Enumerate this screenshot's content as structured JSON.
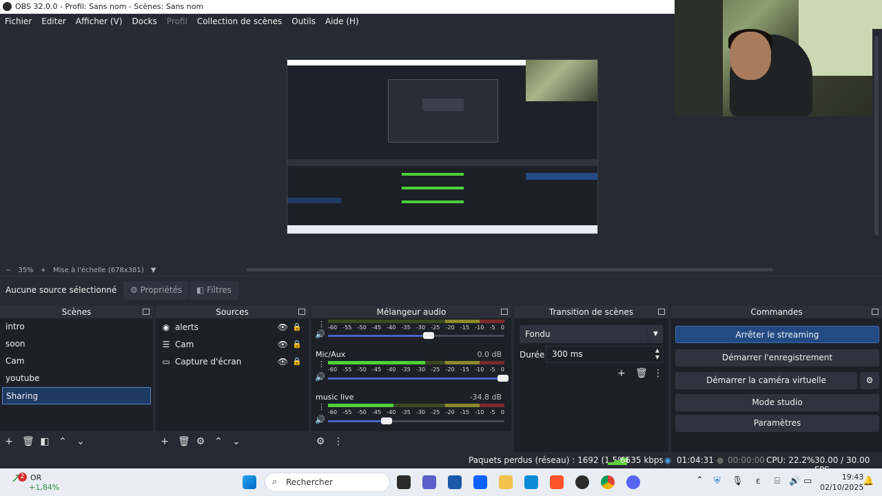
{
  "window": {
    "title": "OBS 32.0.0 - Profil: Sans nom - Scènes: Sans nom"
  },
  "menu": [
    "Fichier",
    "Editer",
    "Afficher (V)",
    "Docks",
    "Profil",
    "Collection de scènes",
    "Outils",
    "Aide (H)"
  ],
  "zoom": {
    "minus": "−",
    "value": "35%",
    "plus": "+",
    "label": "Mise à l'échelle (678x381)"
  },
  "context": {
    "no_source": "Aucune source sélectionné",
    "properties": "Propriétés",
    "filters": "Filtres"
  },
  "scenes": {
    "title": "Scènes",
    "items": [
      "intro",
      "soon",
      "Cam",
      "youtube",
      "Sharing"
    ],
    "active": "Sharing"
  },
  "sources": {
    "title": "Sources",
    "items": [
      {
        "name": "alerts",
        "icon": "browser-icon"
      },
      {
        "name": "Cam",
        "icon": "list-icon"
      },
      {
        "name": "Capture d'écran",
        "icon": "monitor-icon"
      }
    ]
  },
  "mixer": {
    "title": "Mélangeur audio",
    "ticks": [
      "-60",
      "-55",
      "-50",
      "-45",
      "-40",
      "-35",
      "-30",
      "-25",
      "-20",
      "-15",
      "-10",
      "-5",
      "0"
    ],
    "channels": [
      {
        "name": "",
        "db": "",
        "level_fraction": 0.0,
        "volume_fraction": 0.58
      },
      {
        "name": "Mic/Aux",
        "db": "0.0 dB",
        "level_fraction": 0.55,
        "volume_fraction": 1.0
      },
      {
        "name": "music live",
        "db": "-34.8 dB",
        "level_fraction": 0.37,
        "volume_fraction": 0.34
      }
    ]
  },
  "transition": {
    "title": "Transition de scènes",
    "selected": "Fondu",
    "duration_label": "Durée",
    "duration_value": "300 ms"
  },
  "commands": {
    "title": "Commandes",
    "stop_stream": "Arrêter le streaming",
    "start_recording": "Démarrer l'enregistrement",
    "virtual_cam": "Démarrer la caméra virtuelle",
    "studio_mode": "Mode studio",
    "settings": "Paramètres"
  },
  "status": {
    "dropped": "Paquets perdus (réseau) : 1692 (1.5%)",
    "bitrate": "6635 kbps",
    "stream_time": "01:04:31",
    "rec_time": "00:00:00",
    "cpu": "CPU: 22.2%",
    "fps": "30.00 / 30.00 FPS"
  },
  "taskbar": {
    "stock_name": "OR",
    "stock_change": "+1,84%",
    "notifications": "2",
    "search_placeholder": "Rechercher",
    "time": "19:43",
    "date": "02/10/2025",
    "ime": "ε"
  },
  "colors": {
    "accent": "#234a83",
    "meter_green": "#4fd13a",
    "meter_yellow": "#8c8a2c",
    "meter_red": "#7c2a2a",
    "taskbar": "#e9edf3"
  }
}
